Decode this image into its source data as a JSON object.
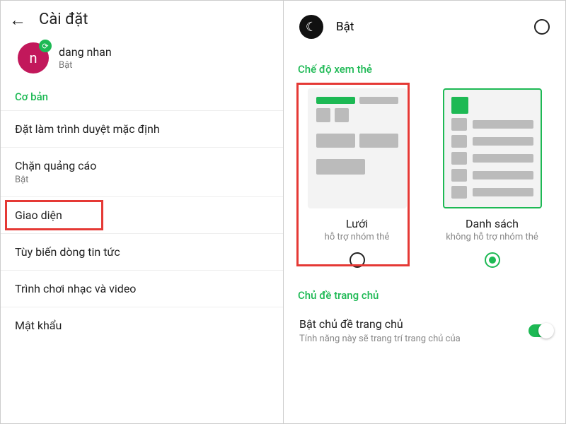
{
  "left": {
    "title": "Cài đặt",
    "profile": {
      "avatar_letter": "n",
      "name": "dang nhan",
      "status": "Bật"
    },
    "section_basic": "Cơ bản",
    "rows": {
      "default_browser": "Đặt làm trình duyệt mặc định",
      "adblock": {
        "label": "Chặn quảng cáo",
        "status": "Bật"
      },
      "ui": "Giao diện",
      "news": "Tùy biến dòng tin tức",
      "media": "Trình chơi nhạc và video",
      "password": "Mật khẩu"
    }
  },
  "right": {
    "dark_label": "Bật",
    "section_card": "Chế độ xem thẻ",
    "grid": {
      "label": "Lưới",
      "sub": "hỗ trợ nhóm thẻ"
    },
    "list": {
      "label": "Danh sách",
      "sub": "không hỗ trợ nhóm thẻ"
    },
    "section_theme": "Chủ đề trang chủ",
    "theme": {
      "label": "Bật chủ đề trang chủ",
      "sub": "Tính năng này sẽ trang trí trang chủ của"
    }
  }
}
